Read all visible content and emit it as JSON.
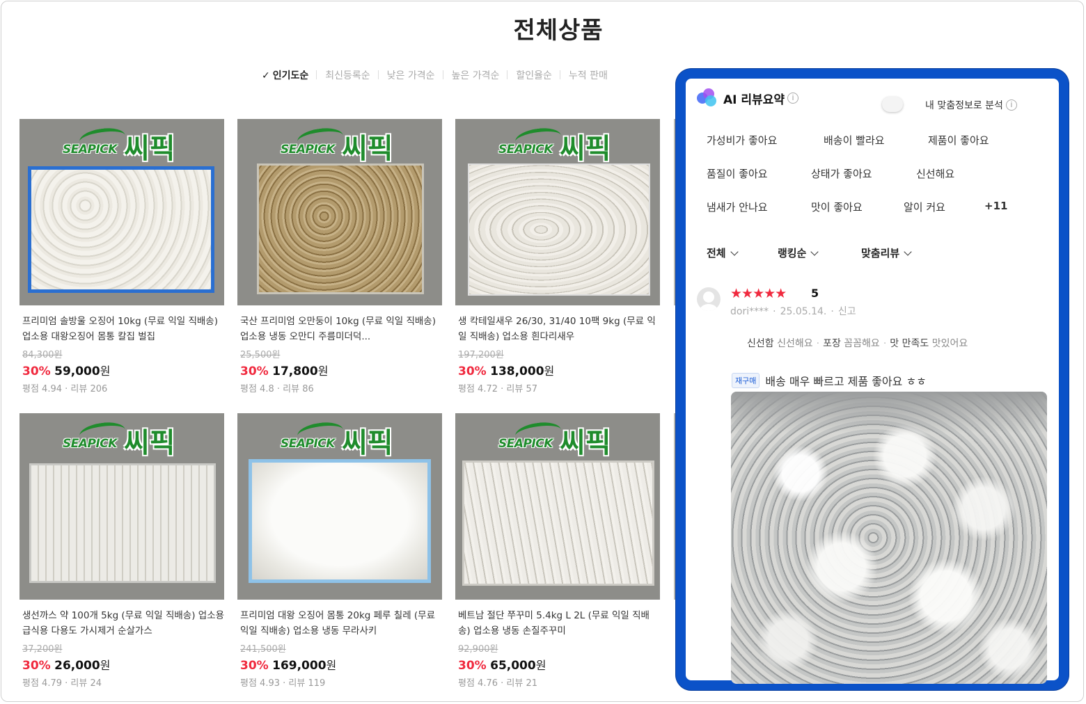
{
  "page": {
    "title": "전체상품"
  },
  "sort": {
    "items": [
      {
        "label": "인기도순",
        "active": true
      },
      {
        "label": "최신등록순"
      },
      {
        "label": "낮은 가격순"
      },
      {
        "label": "높은 가격순"
      },
      {
        "label": "할인율순"
      },
      {
        "label": "누적 판매"
      }
    ]
  },
  "brand": {
    "logo_en": "SEAPICK",
    "logo_ko": "씨픽"
  },
  "products": [
    {
      "name": "프리미엄 솔방울 오징어 10kg (무료 익일 직배송) 업소용 대왕오징어 몸통 칼집 벌집",
      "original_price": "84,300원",
      "discount": "30%",
      "price": "59,000",
      "won": "원",
      "rating": "평점 4.94",
      "reviews": "리뷰 206",
      "image": "squid"
    },
    {
      "name": "국산 프리미엄 오만둥이 10kg (무료 익일 직배송) 업소용 냉동 오만디 주름미더덕...",
      "original_price": "25,500원",
      "discount": "30%",
      "price": "17,800",
      "won": "원",
      "rating": "평점 4.8",
      "reviews": "리뷰 86",
      "image": "beans"
    },
    {
      "name": "생 칵테일새우 26/30, 31/40 10팩 9kg (무료 익일 직배송) 업소용 흰다리새우",
      "original_price": "197,200원",
      "discount": "30%",
      "price": "138,000",
      "won": "원",
      "rating": "평점 4.72",
      "reviews": "리뷰 57",
      "image": "shrimp"
    },
    {
      "name": "생선까스 약 100개 5kg (무료 익일 직배송) 업소용 급식용 다용도 가시제거 순살가스",
      "original_price": "37,200원",
      "discount": "30%",
      "price": "26,000",
      "won": "원",
      "rating": "평점 4.79",
      "reviews": "리뷰 24",
      "image": "fillet"
    },
    {
      "name": "프리미엄 대왕 오징어 몸통 20kg 페루 칠레 (무료 익일 직배송) 업소용 냉동 무라사키",
      "original_price": "241,500원",
      "discount": "30%",
      "price": "169,000",
      "won": "원",
      "rating": "평점 4.93",
      "reviews": "리뷰 119",
      "image": "body"
    },
    {
      "name": "베트남 절단 쭈꾸미 5.4kg L 2L (무료 익일 직배송) 업소용 냉동 손질주꾸미",
      "original_price": "92,900원",
      "discount": "30%",
      "price": "65,000",
      "won": "원",
      "rating": "평점 4.76",
      "reviews": "리뷰 21",
      "image": "octo"
    }
  ],
  "review_panel": {
    "ai_title": "AI 리뷰요약",
    "info_glyph": "i",
    "custom_label": "내 맞춤정보로 분석",
    "tags": [
      "가성비가 좋아요",
      "배송이 빨라요",
      "제품이 좋아요",
      "품질이 좋아요",
      "상태가 좋아요",
      "신선해요",
      "냄새가 안나요",
      "맛이 좋아요",
      "알이 커요",
      "+11"
    ],
    "filters": [
      "전체",
      "랭킹순",
      "맞춤리뷰"
    ],
    "review": {
      "stars": "★★★★★",
      "score": "5",
      "user": "dori****",
      "date": "25.05.14.",
      "report": "신고",
      "summary": [
        {
          "key": "신선함",
          "value": "신선해요"
        },
        {
          "key": "포장",
          "value": "꼼꼼해요"
        },
        {
          "key": "맛 만족도",
          "value": "맛있어요"
        }
      ],
      "badge": "재구매",
      "text": "배송 매우 빠르고 제품 좋아요 ㅎㅎ"
    }
  },
  "colors": {
    "accent_blue": "#0b52c8",
    "discount_red": "#f0293e",
    "brand_green": "#1f8c2c"
  }
}
